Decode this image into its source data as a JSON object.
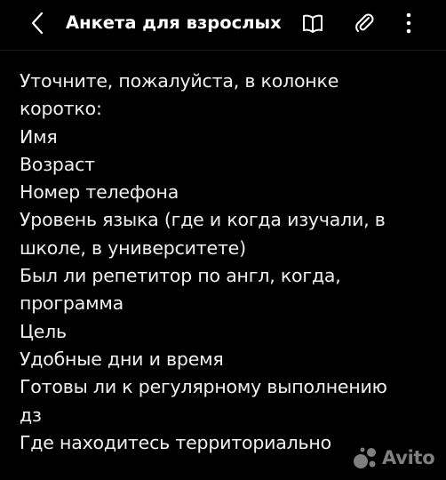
{
  "header": {
    "title": "Анкета для взрослых",
    "back_icon": "chevron-left-icon",
    "book_icon": "book-icon",
    "attach_icon": "paperclip-icon",
    "more_icon": "more-vertical-icon"
  },
  "note": {
    "lines": [
      "Уточните, пожалуйста, в колонке",
      "коротко:",
      "Имя",
      "Возраст",
      "Номер телефона",
      "Уровень языка (где и когда изучали, в",
      "школе, в университете)",
      "Был ли репетитор по англ, когда,",
      "программа",
      "Цель",
      "Удобные дни и время",
      "Готовы ли к регулярному выполнению",
      "дз",
      "Где находитесь территориально"
    ]
  },
  "watermark": {
    "text": "Avito"
  },
  "colors": {
    "background": "#000000",
    "text": "#f0f0f0"
  }
}
